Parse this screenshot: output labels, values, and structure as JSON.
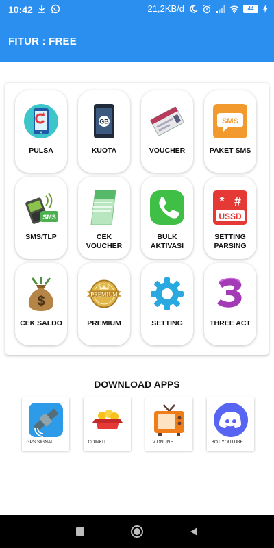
{
  "status_bar": {
    "time": "10:42",
    "network_speed": "21,2KB/d",
    "battery": "44",
    "icons": [
      "download-icon",
      "whatsapp-icon",
      "moon-icon",
      "alarm-icon",
      "signal-icon",
      "wifi-icon",
      "battery-icon",
      "charging-icon"
    ]
  },
  "appbar": {
    "title": "FITUR :  FREE"
  },
  "features": [
    {
      "label": "PULSA",
      "icon": "phone-refill-icon"
    },
    {
      "label": "KUOTA",
      "icon": "gb-phone-icon"
    },
    {
      "label": "VOUCHER",
      "icon": "voucher-card-icon"
    },
    {
      "label": "PAKET SMS",
      "icon": "sms-bubble-icon"
    },
    {
      "label": "SMS/TLP",
      "icon": "sms-phone-icon"
    },
    {
      "label": "CEK\nVOUCHER",
      "icon": "check-voucher-icon"
    },
    {
      "label": "BULK\nAKTIVASI",
      "icon": "phone-call-icon"
    },
    {
      "label": "SETTING\nPARSING",
      "icon": "ussd-icon"
    },
    {
      "label": "CEK SALDO",
      "icon": "money-bag-icon"
    },
    {
      "label": "PREMIUM",
      "icon": "premium-badge-icon"
    },
    {
      "label": "SETTING",
      "icon": "gear-icon"
    },
    {
      "label": "THREE ACT",
      "icon": "three-logo-icon"
    }
  ],
  "ussd_text": "USSD",
  "premium_text": "PREMIUM",
  "download": {
    "title": "DOWNLOAD APPS",
    "apps": [
      {
        "label": "GPS SIGNAL",
        "icon": "satellite-icon"
      },
      {
        "label": "COINKU",
        "icon": "coin-box-icon"
      },
      {
        "label": "TV ONLINE",
        "icon": "tv-icon"
      },
      {
        "label": "BOT YOUTUBE",
        "icon": "discord-icon"
      }
    ]
  },
  "navbar": {
    "icons": [
      "recents-icon",
      "home-icon",
      "back-icon"
    ]
  },
  "colors": {
    "primary": "#2b8ff0",
    "navbar": "#000000"
  }
}
